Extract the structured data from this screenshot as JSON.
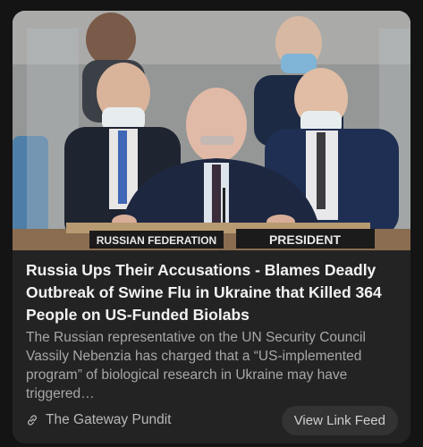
{
  "article": {
    "headline": "Russia Ups Their Accusations - Blames Deadly Outbreak of Swine Flu in Ukraine that Killed 364 People on US-Funded Biolabs",
    "summary": "The Russian representative on the UN Security Council Vassily Nebenzia has charged that a “US-implemented program” of biological research in Ukraine may have triggered…",
    "image": {
      "plate_left": "RUSSIAN FEDERATION",
      "plate_right": "PRESIDENT"
    }
  },
  "footer": {
    "source_icon": "link-icon",
    "source_name": "The Gateway Pundit",
    "button_label": "View Link Feed"
  }
}
